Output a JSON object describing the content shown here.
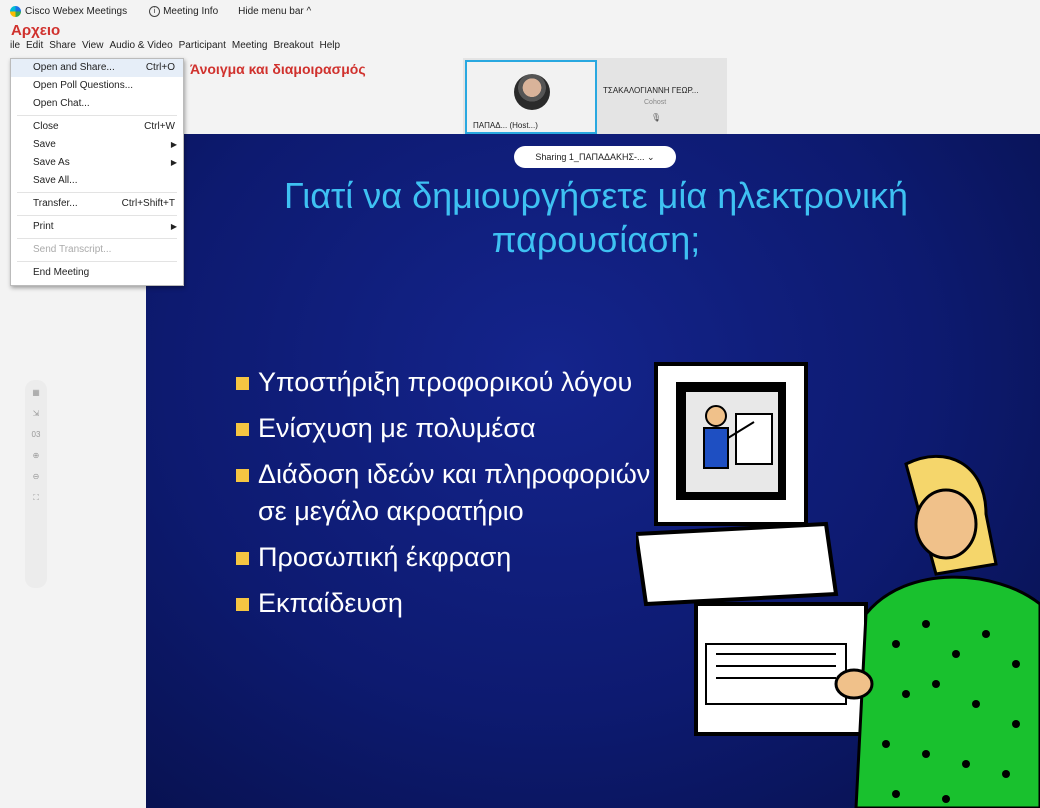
{
  "window": {
    "app_name": "Cisco Webex Meetings",
    "meeting_info": "Meeting Info",
    "hide_menu": "Hide menu bar ^"
  },
  "menubar": [
    "ile",
    "Edit",
    "Share",
    "View",
    "Audio & Video",
    "Participant",
    "Meeting",
    "Breakout",
    "Help"
  ],
  "annotations": {
    "file": "Αρχειο",
    "open_share": "Άνοιγμα και διαμοιρασμός"
  },
  "file_menu": {
    "items": [
      {
        "label": "Open and Share...",
        "shortcut": "Ctrl+O"
      },
      {
        "label": "Open Poll Questions..."
      },
      {
        "label": "Open Chat..."
      },
      {
        "label": "Close",
        "shortcut": "Ctrl+W"
      },
      {
        "label": "Save"
      },
      {
        "label": "Save As"
      },
      {
        "label": "Save All..."
      },
      {
        "label": "Transfer...",
        "shortcut": "Ctrl+Shift+T"
      },
      {
        "label": "Print"
      },
      {
        "label": "Send Transcript..."
      },
      {
        "label": "End Meeting"
      }
    ]
  },
  "participants": {
    "host_label": "ΠΑΠΑΔ... (Host...)",
    "cohost_name": "ΤΣΑΚΑΛΟΓΙΑΝΝΗ ΓΕΩΡ...",
    "cohost_role": "Cohost"
  },
  "slide": {
    "sharing_pill": "Sharing 1_ΠΑΠΑΔΑΚΗΣ-...",
    "title_line1": "Γιατί να δημιουργήσετε μία ηλεκτρονική",
    "title_line2": "παρουσίαση;",
    "bullets": [
      "Υποστήριξη προφορικού λόγου",
      "Ενίσχυση με πολυμέσα",
      "Διάδοση ιδεών και πληροφοριών σε μεγάλο ακροατήριο",
      "Προσωπική έκφραση",
      "Εκπαίδευση"
    ]
  },
  "colors": {
    "slide_bg": "#0d1a70",
    "title": "#3ec1f2",
    "bullet_marker": "#f5c542",
    "annotation_red": "#d0312d",
    "active_speaker_border": "#29a8e0"
  }
}
